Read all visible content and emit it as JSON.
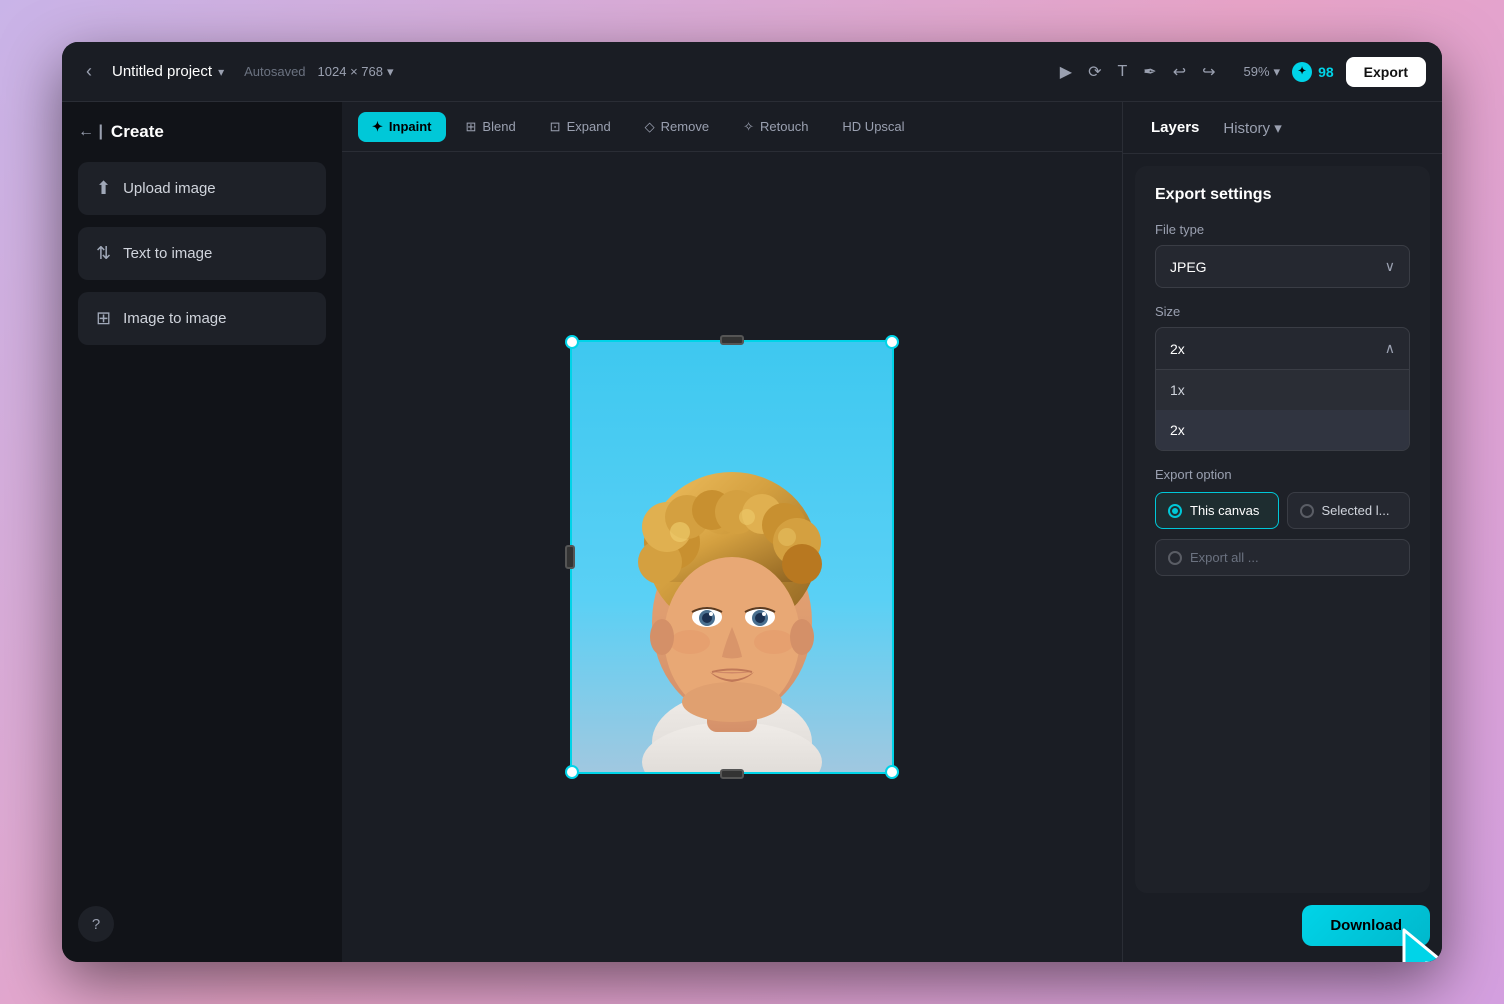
{
  "header": {
    "back_label": "‹",
    "title": "Untitled project",
    "title_chevron": "▾",
    "autosaved": "Autosaved",
    "resolution": "1024 × 768",
    "resolution_chevron": "▾",
    "zoom": "59%",
    "zoom_chevron": "▾",
    "credits": "98",
    "export_label": "Export"
  },
  "toolbar": {
    "tools": [
      {
        "id": "select",
        "icon": "▶",
        "label": ""
      },
      {
        "id": "rotate",
        "icon": "↻",
        "label": ""
      },
      {
        "id": "text",
        "icon": "T",
        "label": ""
      },
      {
        "id": "pen",
        "icon": "✒",
        "label": ""
      },
      {
        "id": "undo",
        "icon": "↩",
        "label": ""
      },
      {
        "id": "redo",
        "icon": "↪",
        "label": ""
      }
    ],
    "mode_buttons": [
      {
        "id": "inpaint",
        "label": "Inpaint",
        "active": true,
        "icon": "✦"
      },
      {
        "id": "blend",
        "label": "Blend",
        "active": false,
        "icon": "⊞"
      },
      {
        "id": "expand",
        "label": "Expand",
        "active": false,
        "icon": "⊡"
      },
      {
        "id": "remove",
        "label": "Remove",
        "active": false,
        "icon": "◇"
      },
      {
        "id": "retouch",
        "label": "Retouch",
        "active": false,
        "icon": "✧"
      },
      {
        "id": "upscal",
        "label": "HD Upscal",
        "active": false,
        "icon": "HD"
      }
    ]
  },
  "sidebar": {
    "header_label": "Create",
    "items": [
      {
        "id": "upload-image",
        "label": "Upload image",
        "icon": "⬆"
      },
      {
        "id": "text-to-image",
        "label": "Text to image",
        "icon": "⇅"
      },
      {
        "id": "image-to-image",
        "label": "Image to image",
        "icon": "⊞"
      }
    ],
    "help_icon": "?"
  },
  "right_panel": {
    "tabs": [
      {
        "id": "layers",
        "label": "Layers",
        "active": true
      },
      {
        "id": "history",
        "label": "History ▾",
        "active": false
      }
    ],
    "export_settings": {
      "title": "Export settings",
      "file_type_label": "File type",
      "file_type_value": "JPEG",
      "size_label": "Size",
      "size_value": "2x",
      "size_options": [
        {
          "id": "1x",
          "label": "1x"
        },
        {
          "id": "2x",
          "label": "2x",
          "selected": true
        }
      ],
      "export_option_label": "Export option",
      "export_options": [
        {
          "id": "this-canvas",
          "label": "This canvas",
          "active": true
        },
        {
          "id": "selected",
          "label": "Selected l...",
          "active": false
        }
      ],
      "export_all_label": "Export all ...",
      "download_label": "Download"
    }
  }
}
